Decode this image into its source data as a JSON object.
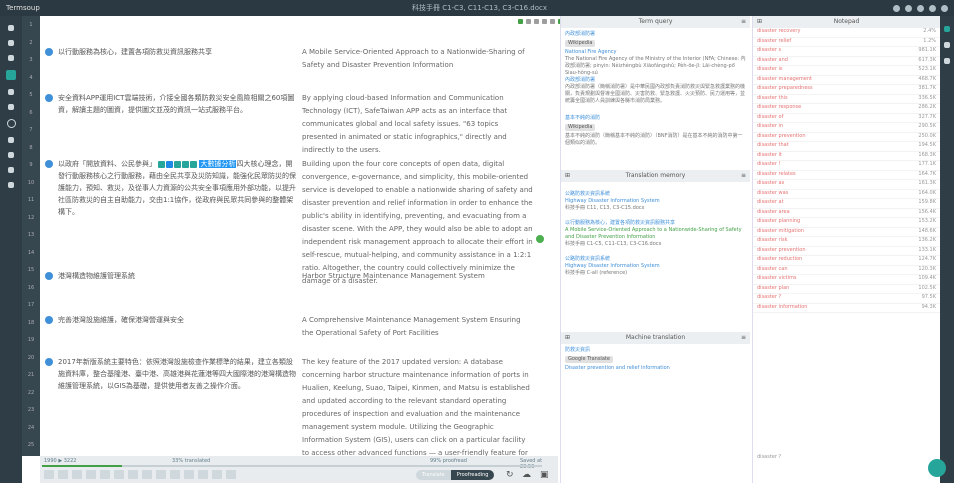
{
  "topbar": {
    "app_title": "Termsoup",
    "file_title": "科技手冊 C1-C3, C11-C13, C3-C16.docx"
  },
  "segments": [
    {
      "num": "8",
      "source": "以行動服務為核心，建置各項防救災資訊服務共享",
      "target": "A Mobile Service-Oriented Approach to a Nationwide-Sharing of Safety and Disaster Prevention Information"
    },
    {
      "num": "9",
      "source": "安全資料APP運用ICT雲端技術，介接全國各類防救災安全風險相關之60項圖資，解讀主題的圖資，提供圖文並茂的資訊一站式服務平台。",
      "target": "By applying cloud-based Information and Communication Technology (ICT), SafeTaiwan APP acts as an interface that communicates global and local safety issues. \"63 topics presented in animated or static infographics,\" directly and indirectly to the users."
    },
    {
      "num": "10",
      "source_pre": "以政府「開放資料、公民參與」",
      "source_highlight": "大數據分析",
      "source_post": "四大核心理念，開發行動服務核心之行動服務，藉由全民共享及災防知識，能強化民眾防災的保護能力，預知、救災，及從事人力資源的公共安全事項應用外部功能，以提升社區防救災的自主自助能力，交由1:1協作，從政府與民眾共同參與的整體架構下。",
      "target": "Building upon the four core concepts of open data, digital convergence, e-governance, and simplicity, this mobile-oriented service is developed to enable a nationwide sharing of safety and disaster prevention and relief information in order to enhance the public's ability in identifying, preventing, and evacuating from a disaster scene. With the APP, they would also be able to adopt an independent risk management approach to allocate their effort in self-rescue, mutual-helping, and community assistance in a 1:2:1 ratio. Altogether, the country could collectively minimize the damage of a disaster."
    },
    {
      "num": "11",
      "source": "港灣構造物維護管理系統",
      "target": "Harbor Structure Maintenance Management System"
    },
    {
      "num": "12",
      "source": "完善港灣設施維護，確保港灣營運與安全",
      "target": "A Comprehensive Maintenance Management System Ensuring the Operational Safety of Port Facilities"
    },
    {
      "num": "13",
      "source": "2017年新版系統主要特色：依照港灣設施檢查作業標準的結果，建立各類設施資料庫，整合基隆港、臺中港、高雄港與花蓮港等四大國際港的港灣構造物維護管理系統，以GIS為基礎，提供使用者友善之操作介面。",
      "target": "The key feature of the 2017 updated version: A database concerning harbor structure maintenance information of ports in Hualien, Keelung, Suao, Taipei, Kinmen, and Matsu is established and updated according to the relevant standard operating procedures of inspection and evaluation and the maintenance management system module. Utilizing the Geographic Information System (GIS), users can click on a particular facility to access other advanced functions — a user-friendly feature for the port authorities."
    }
  ],
  "line_numbers": [
    "1",
    "2",
    "3",
    "4",
    "5",
    "6",
    "7",
    "8",
    "9",
    "10",
    "11",
    "12",
    "13",
    "14",
    "15",
    "16",
    "17",
    "18",
    "19",
    "20",
    "21",
    "22",
    "23",
    "24",
    "25"
  ],
  "bottom": {
    "progress_left": "1990 ▶ 3222",
    "progress_pct": "33% translated",
    "progress_value": 0.16,
    "word_count": "99% proofread",
    "saved": "Saved at 23:59",
    "mode_translate": "Translate",
    "mode_proofread": "Proofreading"
  },
  "term_panel": {
    "title": "Term query",
    "b1_link": "內政部消防署",
    "b1_pill": "Wikipedia",
    "b1_t1": "National Fire Agency",
    "b1_desc": "The National Fire Agency of the Ministry of the Interior (NFA; Chinese: 內政部消防署; pinyin: Nèizhèngbù Xiāofángshǔ; Pe̍h-ōe-jī: Lāi-chèng-pō͘ Siau-hông-sú",
    "b1_t2": "內政部消防署",
    "b1_desc2": "內政部消防署（簡稱消防署）是中華民國內政部負責消防救災與緊急救護業務的機關，負責規劃與督導全國消防、災害防救、緊急救護、火災預防、民力運用等，並統籌全國消防人員訓練與各縣市消防局業務。",
    "b2_link": "基本不純的消防",
    "b2_pill": "Wikipedia",
    "b2_desc": "基本不純的消防（簡稱基本不純的消防）（BNF消防）是在基本不純的消防中第一個類似的消防。"
  },
  "tm_panel": {
    "title": "Translation memory",
    "e1_src": "公路防救災資訊系統",
    "e1_tgt": "Highway Disaster Information System",
    "e1_meta": "科技手冊 C11, C13, C3-C15.docx",
    "e2_src": "以行動服務為核心，建置各項防救災資訊服務共享",
    "e2_tgt": "A Mobile Service-Oriented Approach to a Nationwide-Sharing of Safety and Disaster Prevention Information",
    "e2_meta": "科技手冊 C1-C5, C11-C13, C3-C16.docx",
    "e3_src": "公路防救災資訊系統",
    "e3_tgt": "Highway Disaster Information System",
    "e3_meta": "科技手冊 C-all (reference)"
  },
  "mt_panel": {
    "title": "Machine translation",
    "src": "防救災資訊",
    "pill": "Google Translate",
    "tgt": "Disaster prevention and relief information"
  },
  "notepad": {
    "title": "Notepad",
    "rows": [
      {
        "t": "disaster recovery",
        "v": "2.4%"
      },
      {
        "t": "disaster relief",
        "v": "1.2%"
      },
      {
        "t": "disaster s",
        "v": "981.1K"
      },
      {
        "t": "disaster and",
        "v": "617.3K"
      },
      {
        "t": "disaster is",
        "v": "523.1K"
      },
      {
        "t": "disaster management",
        "v": "468.7K"
      },
      {
        "t": "disaster preparedness",
        "v": "381.7K"
      },
      {
        "t": "disaster this",
        "v": "336.5K"
      },
      {
        "t": "disaster response",
        "v": "286.2K"
      },
      {
        "t": "disaster of",
        "v": "327.7K"
      },
      {
        "t": "disaster in",
        "v": "290.5K"
      },
      {
        "t": "disaster prevention",
        "v": "250.0K"
      },
      {
        "t": "disaster that",
        "v": "194.5K"
      },
      {
        "t": "disaster it",
        "v": "168.3K"
      },
      {
        "t": "disaster !",
        "v": "177.1K"
      },
      {
        "t": "disaster relates",
        "v": "164.7K"
      },
      {
        "t": "disaster as",
        "v": "161.3K"
      },
      {
        "t": "disaster was",
        "v": "164.0K"
      },
      {
        "t": "disaster at",
        "v": "159.8K"
      },
      {
        "t": "disaster area",
        "v": "156.4K"
      },
      {
        "t": "disaster planning",
        "v": "153.2K"
      },
      {
        "t": "disaster mitigation",
        "v": "148.6K"
      },
      {
        "t": "disaster risk",
        "v": "136.2K"
      },
      {
        "t": "disaster prevention",
        "v": "133.1K"
      },
      {
        "t": "disaster reduction",
        "v": "124.7K"
      },
      {
        "t": "disaster can",
        "v": "120.3K"
      },
      {
        "t": "disaster victims",
        "v": "109.4K"
      },
      {
        "t": "disaster plan",
        "v": "102.5K"
      },
      {
        "t": "disaster ?",
        "v": "97.5K"
      },
      {
        "t": "disaster information",
        "v": "94.3K"
      }
    ],
    "footer": "disaster ?"
  }
}
